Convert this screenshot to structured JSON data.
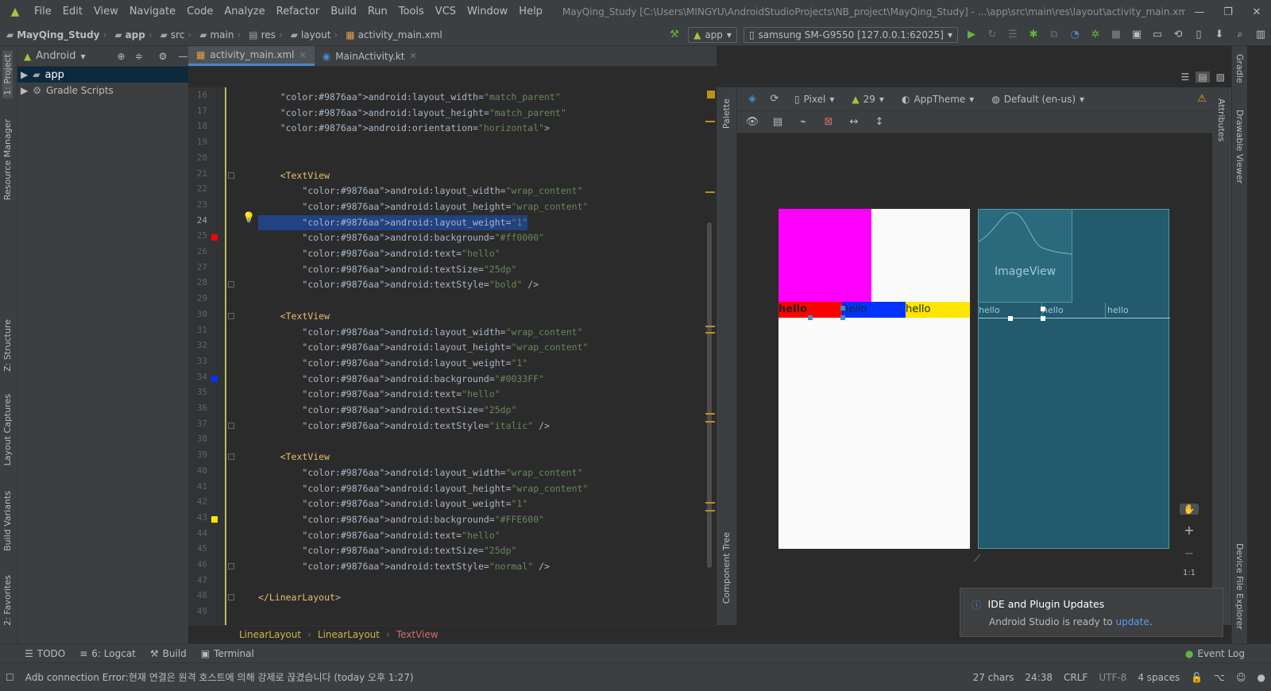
{
  "menubar": {
    "items": [
      "File",
      "Edit",
      "View",
      "Navigate",
      "Code",
      "Analyze",
      "Refactor",
      "Build",
      "Run",
      "Tools",
      "VCS",
      "Window",
      "Help"
    ],
    "title": "MayQing_Study [C:\\Users\\MINGYU\\AndroidStudioProjects\\NB_project\\MayQing_Study] - ...\\app\\src\\main\\res\\layout\\activity_main.xml [app]"
  },
  "breadcrumbs": [
    "MayQing_Study",
    "app",
    "src",
    "main",
    "res",
    "layout",
    "activity_main.xml"
  ],
  "toolbar": {
    "run_config": "app",
    "device": "samsung SM-G9550 [127.0.0.1:62025]"
  },
  "vertical_tabs": {
    "left": [
      "1: Project",
      "Resource Manager",
      "Z: Structure",
      "Layout Captures",
      "Build Variants",
      "2: Favorites"
    ],
    "right": [
      "Gradle",
      "Drawable Viewer",
      "Device File Explorer"
    ],
    "designer": [
      "Palette",
      "Component Tree",
      "Attributes"
    ]
  },
  "project": {
    "view": "Android",
    "tree": [
      "app",
      "Gradle Scripts"
    ]
  },
  "tabs": [
    "activity_main.xml",
    "MainActivity.kt"
  ],
  "code": [
    {
      "n": 16,
      "t": "    android:layout_width=\"match_parent\""
    },
    {
      "n": 17,
      "t": "    android:layout_height=\"match_parent\""
    },
    {
      "n": 18,
      "t": "    android:orientation=\"horizontal\">"
    },
    {
      "n": 19,
      "t": ""
    },
    {
      "n": 20,
      "t": ""
    },
    {
      "n": 21,
      "t": "    <TextView"
    },
    {
      "n": 22,
      "t": "        android:layout_width=\"wrap_content\""
    },
    {
      "n": 23,
      "t": "        android:layout_height=\"wrap_content\""
    },
    {
      "n": 24,
      "t": "        android:layout_weight=\"1\""
    },
    {
      "n": 25,
      "t": "        android:background=\"#ff0000\""
    },
    {
      "n": 26,
      "t": "        android:text=\"hello\""
    },
    {
      "n": 27,
      "t": "        android:textSize=\"25dp\""
    },
    {
      "n": 28,
      "t": "        android:textStyle=\"bold\" />"
    },
    {
      "n": 29,
      "t": ""
    },
    {
      "n": 30,
      "t": "    <TextView"
    },
    {
      "n": 31,
      "t": "        android:layout_width=\"wrap_content\""
    },
    {
      "n": 32,
      "t": "        android:layout_height=\"wrap_content\""
    },
    {
      "n": 33,
      "t": "        android:layout_weight=\"1\""
    },
    {
      "n": 34,
      "t": "        android:background=\"#0033FF\""
    },
    {
      "n": 35,
      "t": "        android:text=\"hello\""
    },
    {
      "n": 36,
      "t": "        android:textSize=\"25dp\""
    },
    {
      "n": 37,
      "t": "        android:textStyle=\"italic\" />"
    },
    {
      "n": 38,
      "t": ""
    },
    {
      "n": 39,
      "t": "    <TextView"
    },
    {
      "n": 40,
      "t": "        android:layout_width=\"wrap_content\""
    },
    {
      "n": 41,
      "t": "        android:layout_height=\"wrap_content\""
    },
    {
      "n": 42,
      "t": "        android:layout_weight=\"1\""
    },
    {
      "n": 43,
      "t": "        android:background=\"#FFE600\""
    },
    {
      "n": 44,
      "t": "        android:text=\"hello\""
    },
    {
      "n": 45,
      "t": "        android:textSize=\"25dp\""
    },
    {
      "n": 46,
      "t": "        android:textStyle=\"normal\" />"
    },
    {
      "n": 47,
      "t": ""
    },
    {
      "n": 48,
      "t": "</LinearLayout>"
    },
    {
      "n": 49,
      "t": ""
    }
  ],
  "current_line": 24,
  "swatches": [
    {
      "line": 25,
      "color": "#ff0000"
    },
    {
      "line": 34,
      "color": "#0033FF"
    },
    {
      "line": 43,
      "color": "#FFE600"
    }
  ],
  "editor_breadcrumb": [
    "LinearLayout",
    "LinearLayout",
    "TextView"
  ],
  "designer": {
    "device": "Pixel",
    "api": "29",
    "theme": "AppTheme",
    "locale": "Default (en-us)",
    "preview_text": "hello",
    "imageview_label": "ImageView",
    "zoom_label": "1:1"
  },
  "notification": {
    "title": "IDE and Plugin Updates",
    "body": "Android Studio is ready to",
    "link": "update",
    "tail": "."
  },
  "bottom_tools": [
    "TODO",
    "6: Logcat",
    "Build",
    "Terminal"
  ],
  "event_log": "Event Log",
  "status": {
    "message": "Adb connection Error:현재 연결은 원격 호스트에 의해 강제로 끊겼습니다 (today 오후 1:27)",
    "chars": "27 chars",
    "position": "24:38",
    "line_sep": "CRLF",
    "encoding": "UTF-8",
    "indent": "4 spaces"
  },
  "colors": {
    "magenta": "#ff00ff",
    "red": "#ff0000",
    "blue": "#0033ff",
    "yellow": "#ffe600",
    "accent": "#4a88c7"
  }
}
